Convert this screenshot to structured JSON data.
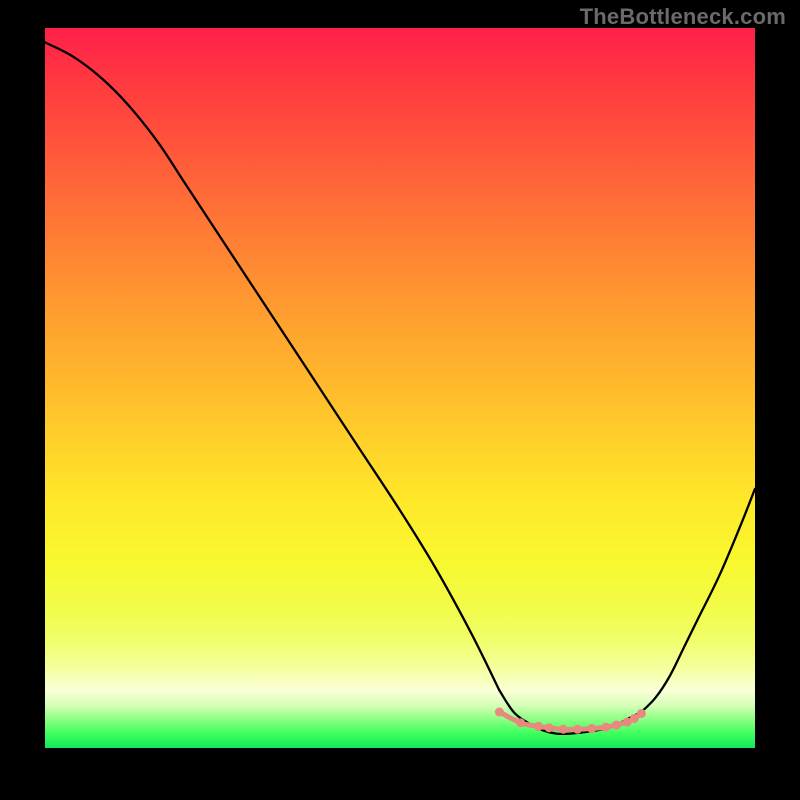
{
  "watermark": "TheBottleneck.com",
  "colors": {
    "background": "#000000",
    "curve": "#000000",
    "ticks": "#e8887e"
  },
  "chart_data": {
    "type": "line",
    "title": "",
    "xlabel": "",
    "ylabel": "",
    "xlim": [
      0,
      100
    ],
    "ylim": [
      0,
      100
    ],
    "grid": false,
    "series": [
      {
        "name": "left-descent",
        "x": [
          0,
          4,
          8,
          12,
          16,
          20,
          26,
          32,
          38,
          44,
          50,
          55,
          60,
          64
        ],
        "values": [
          98,
          96,
          93,
          89,
          84,
          78,
          69,
          60,
          51,
          42,
          33,
          25,
          16,
          8
        ]
      },
      {
        "name": "trough",
        "x": [
          64,
          66,
          68,
          70,
          72,
          74,
          76,
          78,
          80,
          82,
          84
        ],
        "values": [
          8,
          5,
          3.5,
          2.5,
          2,
          2,
          2.2,
          2.5,
          3,
          4,
          5
        ]
      },
      {
        "name": "right-ascent",
        "x": [
          84,
          86,
          88,
          90,
          92,
          95,
          98,
          100
        ],
        "values": [
          5,
          7,
          10,
          14,
          18,
          24,
          31,
          36
        ]
      }
    ],
    "marker_points": {
      "name": "salmon-tick-band",
      "x": [
        64,
        67,
        69.5,
        71,
        73,
        75,
        77,
        79,
        80.5,
        82,
        83,
        84
      ],
      "values": [
        5,
        3.5,
        3,
        2.8,
        2.6,
        2.6,
        2.7,
        2.9,
        3.2,
        3.6,
        4.1,
        4.8
      ]
    },
    "background_gradient": {
      "direction": "top-to-bottom",
      "stops": [
        {
          "pos": 0,
          "color": "#ff1f4a"
        },
        {
          "pos": 18,
          "color": "#ff5a3a"
        },
        {
          "pos": 38,
          "color": "#ff9930"
        },
        {
          "pos": 58,
          "color": "#ffd22a"
        },
        {
          "pos": 80,
          "color": "#f2fb45"
        },
        {
          "pos": 92,
          "color": "#fbffd7"
        },
        {
          "pos": 100,
          "color": "#12e85c"
        }
      ]
    }
  }
}
